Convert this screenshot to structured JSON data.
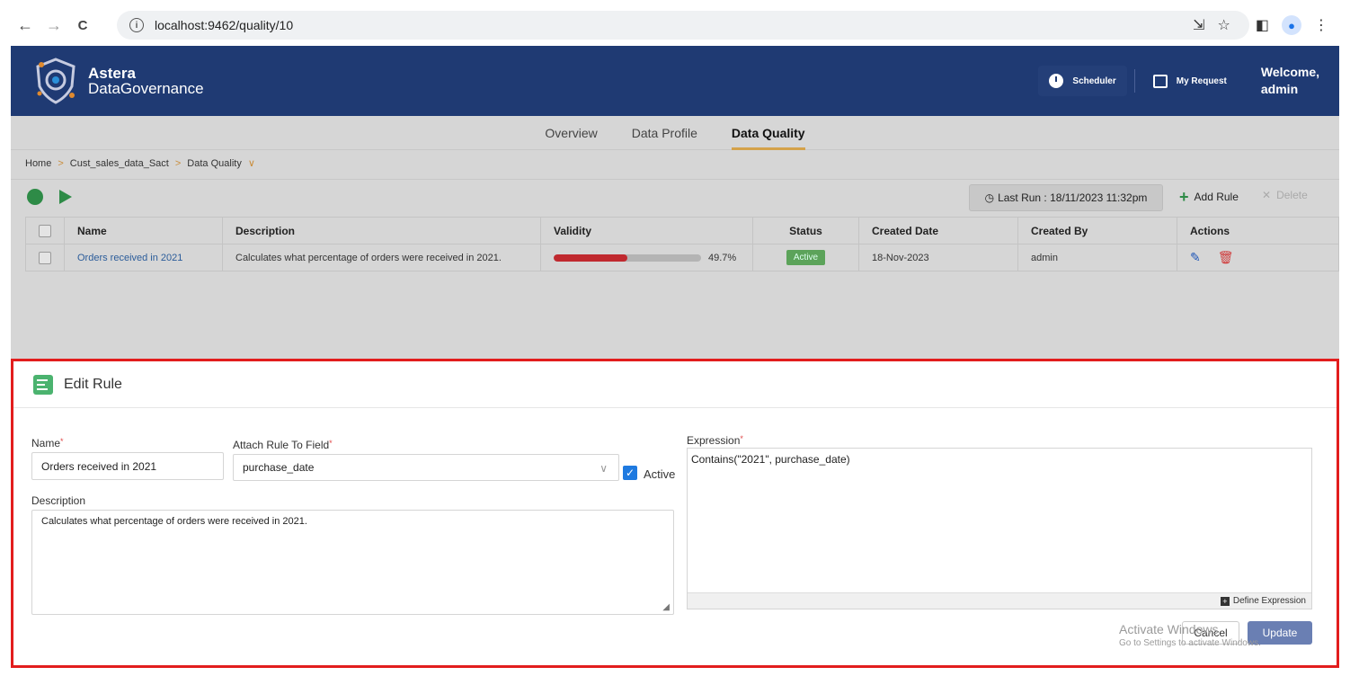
{
  "browser": {
    "url": "localhost:9462/quality/10",
    "back": "←",
    "forward": "→",
    "reload": "C",
    "info": "i",
    "icons": {
      "install": "⇲",
      "star": "☆",
      "sidepanel": "◧",
      "profile": "●",
      "menu": "⋮"
    }
  },
  "header": {
    "brand_line1": "Astera",
    "brand_line2": "DataGovernance",
    "scheduler": "Scheduler",
    "my_request": "My Request",
    "welcome_line1": "Welcome,",
    "welcome_line2": "admin"
  },
  "tabs": [
    {
      "label": "Overview"
    },
    {
      "label": "Data Profile"
    },
    {
      "label": "Data Quality"
    }
  ],
  "breadcrumb": {
    "home": "Home",
    "dataset": "Cust_sales_data_Sact",
    "current": "Data Quality",
    "sep": ">",
    "chevron": "∨"
  },
  "toolbar": {
    "last_run": "Last Run : 18/11/2023 11:32pm",
    "add_rule": "Add Rule",
    "add_icon": "+",
    "delete": "Delete",
    "delete_icon": "✕"
  },
  "table": {
    "headers": [
      "Name",
      "Description",
      "Validity",
      "Status",
      "Created Date",
      "Created By",
      "Actions"
    ],
    "rows": [
      {
        "name": "Orders received in 2021",
        "description": "Calculates what percentage of orders were received in 2021.",
        "validity_text": "49.7%",
        "validity": 0.497,
        "status": "Active",
        "created_date": "18-Nov-2023",
        "created_by": "admin",
        "edit_icon": "✎",
        "delete_icon": "🗑"
      }
    ]
  },
  "edit_rule": {
    "title": "Edit Rule",
    "name_label": "Name",
    "name_value": "Orders received in 2021",
    "attach_label": "Attach Rule To Field",
    "attach_value": "purchase_date",
    "chevron": "∨",
    "active_label": "Active",
    "check": "✓",
    "description_label": "Description",
    "description_value": "Calculates what percentage of orders were received in 2021.",
    "expression_label": "Expression",
    "expression_value": "Contains(\"2021\", purchase_date)",
    "define_expression": "Define Expression",
    "define_icon": "+",
    "resize": "◢",
    "required": "*",
    "cancel": "Cancel",
    "update": "Update"
  },
  "watermark": {
    "line1": "Activate Windows",
    "line2": "Go to Settings to activate Windows."
  }
}
